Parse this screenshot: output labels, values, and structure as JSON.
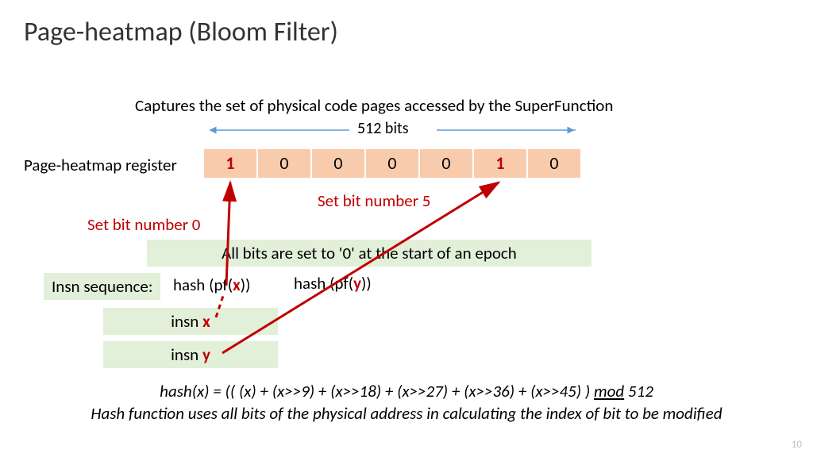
{
  "title": "Page-heatmap (Bloom Filter)",
  "subtitle": "Captures the set of physical code pages accessed by the SuperFunction",
  "width_label": "512 bits",
  "register_label": "Page-heatmap register",
  "bits": [
    "1",
    "0",
    "0",
    "0",
    "0",
    "1",
    "0"
  ],
  "set_note_5": "Set bit number 5",
  "set_note_0": "Set bit number 0",
  "epoch_note": "All bits are set to '0' at the start of an epoch",
  "insn_label": "Insn sequence:",
  "hash_x_pre": "hash (pf(",
  "hash_x_var": "x",
  "hash_x_post": "))",
  "hash_y_pre": "hash (pf(",
  "hash_y_var": "y",
  "hash_y_post": "))",
  "insn_x_pre": "insn  ",
  "insn_x_var": "x",
  "insn_y_pre": "insn  ",
  "insn_y_var": "y",
  "formula": "hash(x) = (( (x) + (x>>9) + (x>>18) + (x>>27) + (x>>36) + (x>>45) ) ",
  "formula_mod": "mod",
  "formula_end": " 512",
  "formula_note": "Hash function uses all bits of the physical address in calculating the index of bit to be modified",
  "page_number": "10"
}
